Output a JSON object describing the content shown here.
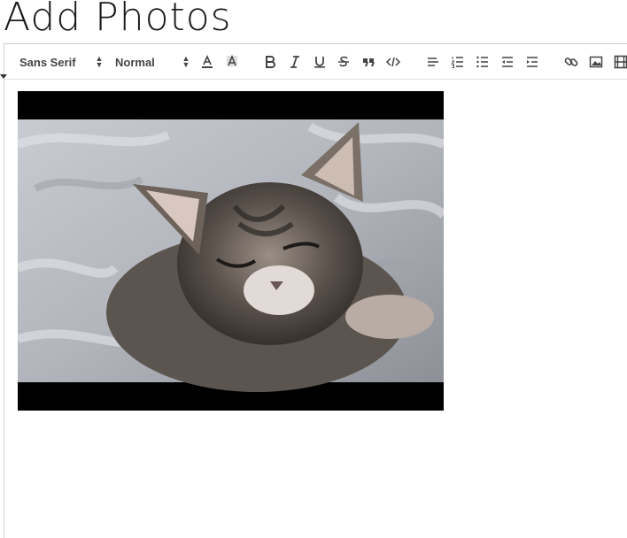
{
  "page": {
    "title": "Add Photos"
  },
  "toolbar": {
    "font_picker": {
      "value": "Sans Serif",
      "icon": "updown-arrows-icon"
    },
    "size_picker": {
      "value": "Normal",
      "icon": "updown-arrows-icon"
    },
    "buttons": [
      {
        "name": "font-color",
        "icon": "font-color-icon"
      },
      {
        "name": "background-color",
        "icon": "background-color-icon"
      },
      {
        "name": "bold",
        "icon": "bold-icon"
      },
      {
        "name": "italic",
        "icon": "italic-icon"
      },
      {
        "name": "underline",
        "icon": "underline-icon"
      },
      {
        "name": "strikethrough",
        "icon": "strikethrough-icon"
      },
      {
        "name": "blockquote",
        "icon": "quote-icon"
      },
      {
        "name": "code-block",
        "icon": "code-icon"
      },
      {
        "name": "align",
        "icon": "align-left-icon"
      },
      {
        "name": "ordered-list",
        "icon": "ordered-list-icon"
      },
      {
        "name": "bullet-list",
        "icon": "bullet-list-icon"
      },
      {
        "name": "outdent",
        "icon": "outdent-icon"
      },
      {
        "name": "indent",
        "icon": "indent-icon"
      },
      {
        "name": "link",
        "icon": "link-icon"
      },
      {
        "name": "image",
        "icon": "image-icon"
      },
      {
        "name": "video",
        "icon": "video-icon"
      }
    ]
  },
  "editor": {
    "embedded_image": {
      "subject": "sleepy kitten on a grey blanket",
      "letterbox_color": "#000000"
    }
  },
  "colors": {
    "toolbar_icon": "#444444",
    "border": "#cccccc",
    "background": "#ffffff"
  }
}
